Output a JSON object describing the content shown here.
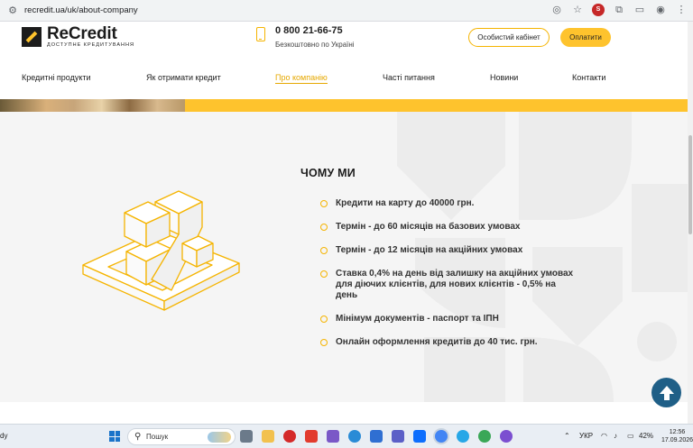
{
  "browser": {
    "url": "recredit.ua/uk/about-company"
  },
  "header": {
    "logo_name": "ReCredit",
    "logo_tagline": "ДОСТУПНЕ КРЕДИТУВАННЯ",
    "phone": "0 800 21-66-75",
    "phone_note": "Безкоштовно по Україні",
    "cabinet_label": "Особистий кабінет",
    "pay_label": "Оплатити"
  },
  "nav": {
    "items": [
      {
        "label": "Кредитні продукти",
        "active": false
      },
      {
        "label": "Як отримати кредит",
        "active": false
      },
      {
        "label": "Про компанію",
        "active": true
      },
      {
        "label": "Часті питання",
        "active": false
      },
      {
        "label": "Новини",
        "active": false
      },
      {
        "label": "Контакти",
        "active": false
      }
    ]
  },
  "why": {
    "title": "ЧОМУ МИ",
    "benefits": [
      "Кредити на карту до 40000 грн.",
      "Термін - до 60 місяців на базових умовах",
      "Термін - до 12 місяців на акційних умовах",
      "Ставка 0,4% на день від залишку на акційних умовах для діючих клієнтів, для нових клієнтів - 0,5% на день",
      "Мінімум документів - паспорт та ІПН",
      "Онлайн оформлення кредитів до 40 тис. грн."
    ]
  },
  "colors": {
    "brand_yellow": "#fec32d",
    "accent_text": "#e6a800",
    "dark": "#1c1c1c",
    "scroll_button": "#1f5f87"
  },
  "taskbar": {
    "left_text": "dy",
    "search_label": "Пошук",
    "lang": "УКР",
    "battery": "42%",
    "time": "12:56",
    "date": "17.09.2026"
  }
}
